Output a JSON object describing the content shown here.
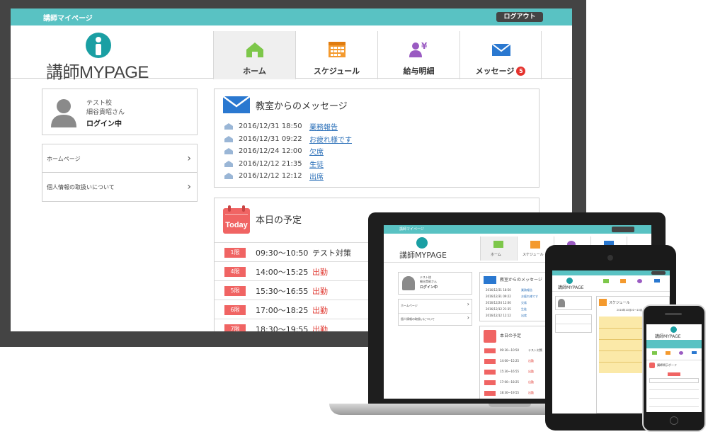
{
  "topbar": {
    "title": "講師マイページ",
    "logout_label": "ログアウト"
  },
  "logo": {
    "text": "講師MYPAGE"
  },
  "nav": {
    "home": "ホーム",
    "schedule": "スケジュール",
    "payslip": "給与明細",
    "messages": "メッセージ",
    "message_count": "5"
  },
  "profile": {
    "school": "テスト校",
    "teacher_name": "細谷貴昭さん",
    "status": "ログイン中"
  },
  "side_links": {
    "homepage": "ホームページ",
    "privacy": "個人情報の取扱いについて"
  },
  "messages_panel": {
    "title": "教室からのメッセージ",
    "items": [
      {
        "date": "2016/12/31 18:50",
        "subject": "業務報告"
      },
      {
        "date": "2016/12/31 09:22",
        "subject": "お疲れ様です"
      },
      {
        "date": "2016/12/24 12:00",
        "subject": "欠席"
      },
      {
        "date": "2016/12/12 21:35",
        "subject": "生徒"
      },
      {
        "date": "2016/12/12 12:12",
        "subject": "出席"
      }
    ]
  },
  "today_panel": {
    "title": "本日の予定",
    "calendar_label": "Today",
    "rows": [
      {
        "period": "1限",
        "time": "09:30〜10:50",
        "note": "テスト対策"
      },
      {
        "period": "4限",
        "time": "14:00〜15:25",
        "note": "出勤"
      },
      {
        "period": "5限",
        "time": "15:30〜16:55",
        "note": "出勤"
      },
      {
        "period": "6限",
        "time": "17:00〜18:25",
        "note": "出勤"
      },
      {
        "period": "7限",
        "time": "18:30〜19:55",
        "note": "出勤"
      }
    ]
  },
  "tablet": {
    "schedule_title": "スケジュール",
    "schedule_month": "2016年10月01〜10月"
  },
  "phone": {
    "notice": "講師掲示ボード"
  },
  "colors": {
    "teal": "#59c2c3",
    "logo_teal": "#1a9fa3",
    "red": "#f06463",
    "badge": "#e5322d",
    "link": "#2a6fb8"
  }
}
